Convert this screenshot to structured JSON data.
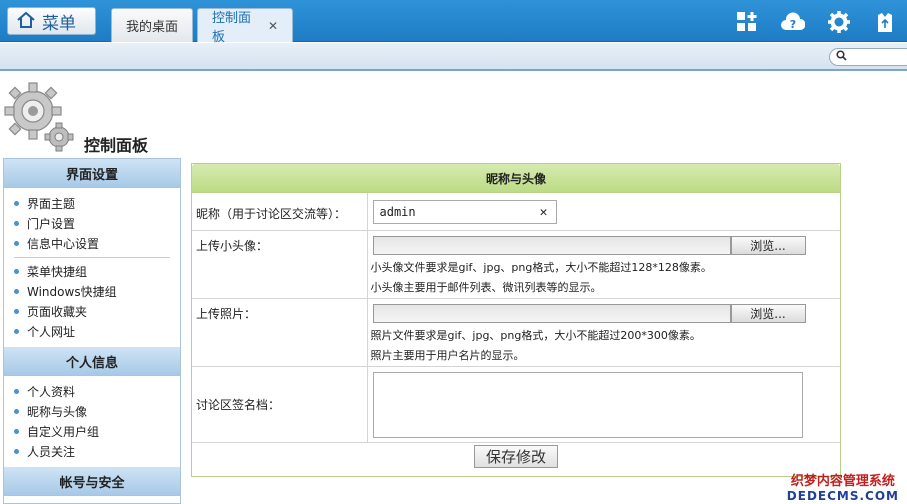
{
  "topbar": {
    "menu_label": "菜单",
    "tabs": [
      {
        "label": "我的桌面"
      },
      {
        "label": "控制面板",
        "close": "✕"
      }
    ]
  },
  "header": {
    "title": "控制面板"
  },
  "sidebar": {
    "sections": [
      {
        "title": "界面设置",
        "items": [
          "界面主题",
          "门户设置",
          "信息中心设置"
        ],
        "items2": [
          "菜单快捷组",
          "Windows快捷组",
          "页面收藏夹",
          "个人网址"
        ]
      },
      {
        "title": "个人信息",
        "items": [
          "个人资料",
          "昵称与头像",
          "自定义用户组",
          "人员关注"
        ]
      },
      {
        "title": "帐号与安全"
      }
    ]
  },
  "panel": {
    "title": "昵称与头像",
    "nickname_label": "昵称（用于讨论区交流等）：",
    "nickname_value": "admin",
    "clear_glyph": "✕",
    "small_avatar_label": "上传小头像：",
    "browse_label": "浏览...",
    "small_hint_1": "小头像文件要求是gif、jpg、png格式，大小不能超过128*128像素。",
    "small_hint_2": "小头像主要用于邮件列表、微讯列表等的显示。",
    "photo_label": "上传照片：",
    "photo_hint_1": "照片文件要求是gif、jpg、png格式，大小不能超过200*300像素。",
    "photo_hint_2": "照片主要用于用户名片的显示。",
    "signature_label": "讨论区签名档：",
    "save_label": "保存修改"
  },
  "watermark": {
    "line1": "织梦内容管理系统",
    "line2": "DEDECMS.COM"
  }
}
